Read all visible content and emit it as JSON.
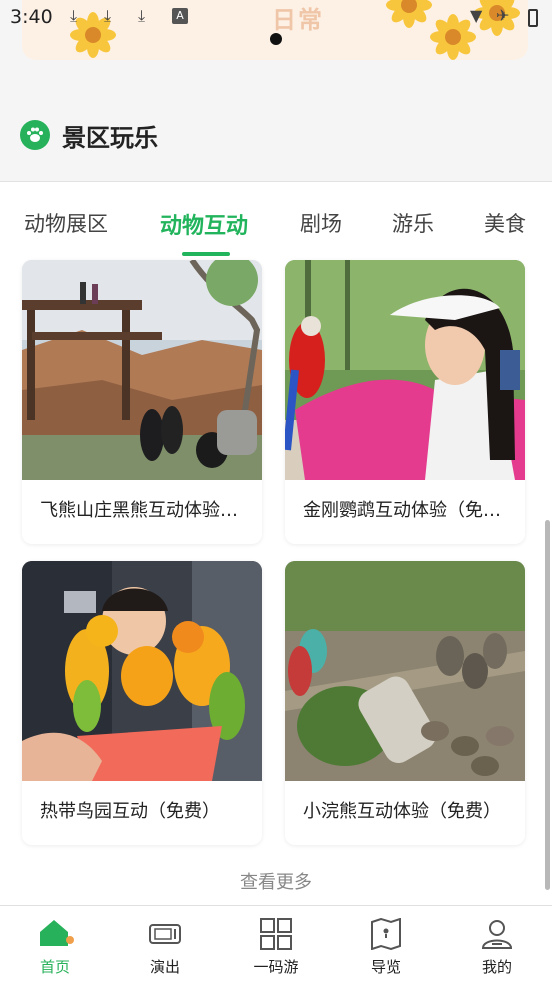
{
  "status_bar": {
    "time": "3:40"
  },
  "banner": {
    "text": "日常"
  },
  "section": {
    "title": "景区玩乐"
  },
  "tabs": [
    {
      "label": "动物展区",
      "active": false
    },
    {
      "label": "动物互动",
      "active": true
    },
    {
      "label": "剧场",
      "active": false
    },
    {
      "label": "游乐",
      "active": false
    },
    {
      "label": "美食",
      "active": false
    }
  ],
  "cards": [
    {
      "title": "飞熊山庄黑熊互动体验（免费）",
      "image": "bear-enclosure-photo"
    },
    {
      "title": "金刚鹦鹉互动体验（免费）",
      "image": "macaw-photo"
    },
    {
      "title": "热带鸟园互动（免费）",
      "image": "parakeets-photo"
    },
    {
      "title": "小浣熊互动体验（免费）",
      "image": "raccoon-enclosure-photo"
    }
  ],
  "more_label": "查看更多",
  "nav": [
    {
      "label": "首页",
      "icon": "home-icon",
      "active": true
    },
    {
      "label": "演出",
      "icon": "stage-icon",
      "active": false
    },
    {
      "label": "一码游",
      "icon": "qr-grid-icon",
      "active": false
    },
    {
      "label": "导览",
      "icon": "map-icon",
      "active": false
    },
    {
      "label": "我的",
      "icon": "user-icon",
      "active": false
    }
  ],
  "colors": {
    "accent": "#22b45c",
    "banner_bg": "#fdf1e6",
    "page_bg": "#f5f5f5"
  }
}
